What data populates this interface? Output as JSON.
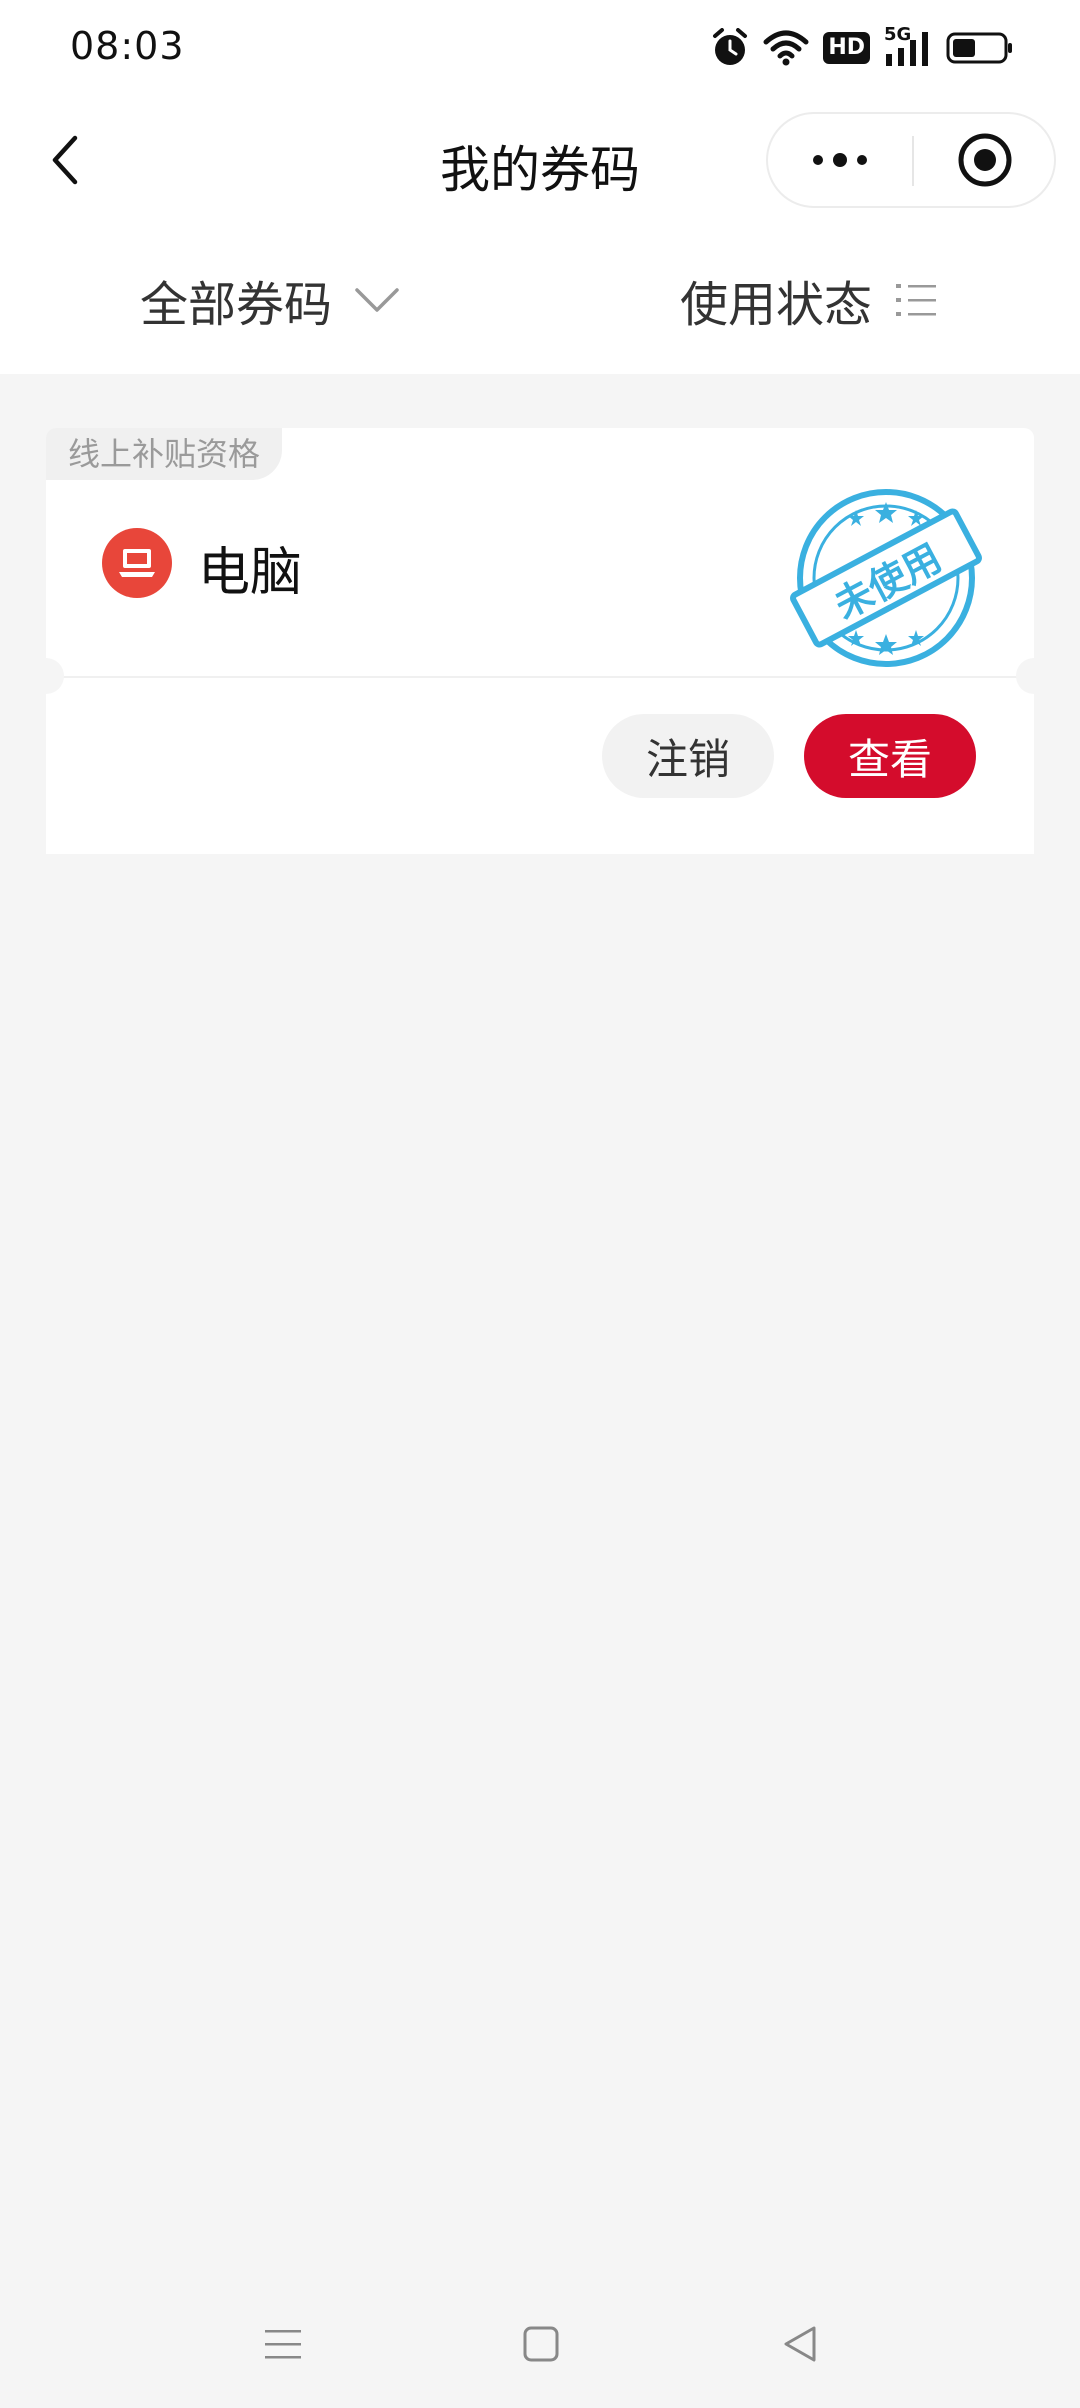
{
  "status_bar": {
    "time": "08:03",
    "icons": [
      "alarm-icon",
      "wifi-icon",
      "hd-icon",
      "5g-signal-icon",
      "battery-icon"
    ],
    "hd_label": "HD",
    "network_label": "5G"
  },
  "nav": {
    "title": "我的券码",
    "back_icon": "chevron-left-icon",
    "more_icon": "more-dots-icon",
    "close_icon": "target-circle-icon"
  },
  "filters": {
    "all_label": "全部券码",
    "status_label": "使用状态"
  },
  "coupons": [
    {
      "tag": "线上补贴资格",
      "name": "电脑",
      "icon": "laptop-icon",
      "stamp_text": "未使用",
      "actions": {
        "cancel_label": "注销",
        "view_label": "查看"
      }
    }
  ],
  "colors": {
    "accent_red": "#d40c2c",
    "icon_red": "#e8463a",
    "stamp_blue": "#3ab0e0",
    "background": "#f5f5f5"
  },
  "system_nav": {
    "icons": [
      "menu-icon",
      "home-square-icon",
      "back-triangle-icon"
    ]
  }
}
